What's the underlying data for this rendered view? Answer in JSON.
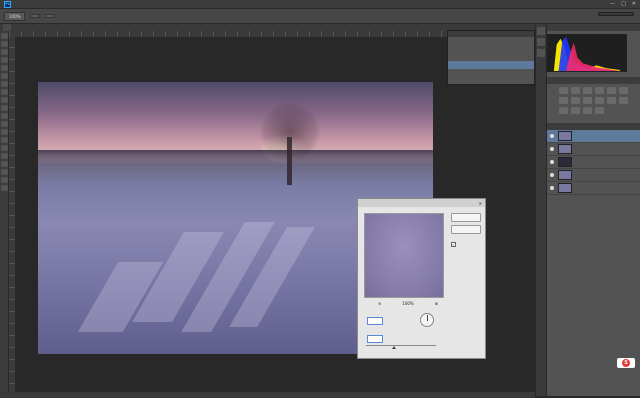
{
  "menubar": {
    "logo": "Ps",
    "items": [
      "",
      "",
      "",
      "",
      "",
      "",
      "",
      "",
      "",
      ""
    ]
  },
  "window": {
    "minimize": "—",
    "maximize": "□",
    "close": "✕"
  },
  "options": {
    "zoom_value": "100%",
    "btn_fit": "",
    "btn_fill": ""
  },
  "document_tab": {
    "label": ""
  },
  "history_popup": {
    "items": [
      "",
      "",
      "",
      ""
    ],
    "selected_index": 3
  },
  "filter_dialog": {
    "title": "",
    "ok_label": "",
    "reset_label": "",
    "preview_checked": true,
    "preview_label": "",
    "zoom_percent": "100%",
    "angle_label": "",
    "angle_value": "",
    "angle_unit": "",
    "distance_label": "",
    "distance_value": "",
    "distance_unit": ""
  },
  "layers": [
    {
      "name": "",
      "selected": true,
      "thumb": "light"
    },
    {
      "name": "",
      "selected": false,
      "thumb": "light"
    },
    {
      "name": "",
      "selected": false,
      "thumb": "dark"
    },
    {
      "name": "",
      "selected": false,
      "thumb": "light"
    },
    {
      "name": "",
      "selected": false,
      "thumb": "light"
    }
  ],
  "colors": {
    "accent_selection": "#5d7a9a",
    "panel_bg": "#535353",
    "canvas_bg": "#282828"
  }
}
